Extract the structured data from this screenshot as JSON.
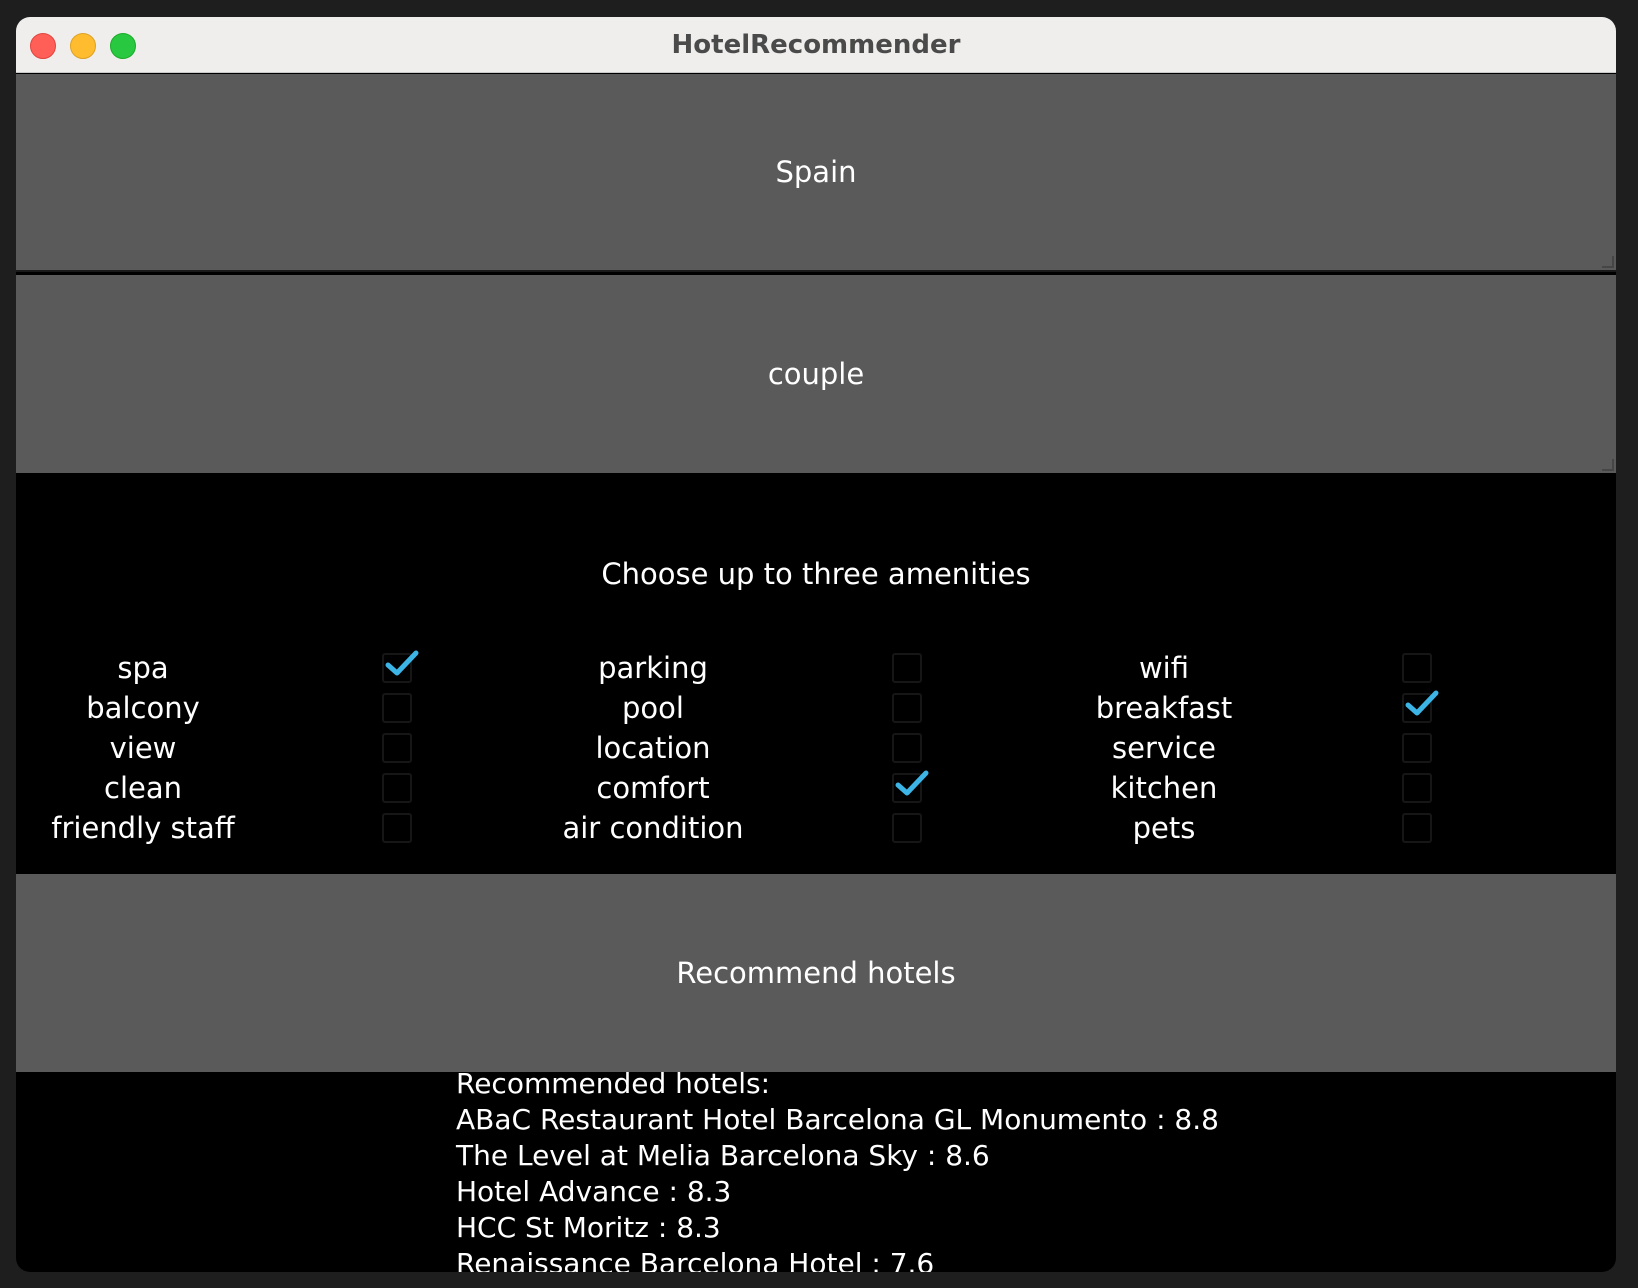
{
  "window": {
    "title": "HotelRecommender"
  },
  "country_field": {
    "value": "Spain"
  },
  "traveler_field": {
    "value": "couple"
  },
  "amenities": {
    "heading": "Choose up to three amenities",
    "columns": [
      [
        {
          "label": "spa",
          "checked": true
        },
        {
          "label": "balcony",
          "checked": false
        },
        {
          "label": "view",
          "checked": false
        },
        {
          "label": "clean",
          "checked": false
        },
        {
          "label": "friendly staff",
          "checked": false
        }
      ],
      [
        {
          "label": "parking",
          "checked": false
        },
        {
          "label": "pool",
          "checked": false
        },
        {
          "label": "location",
          "checked": false
        },
        {
          "label": "comfort",
          "checked": true
        },
        {
          "label": "air condition",
          "checked": false
        }
      ],
      [
        {
          "label": "wifi",
          "checked": false
        },
        {
          "label": "breakfast",
          "checked": true
        },
        {
          "label": "service",
          "checked": false
        },
        {
          "label": "kitchen",
          "checked": false
        },
        {
          "label": "pets",
          "checked": false
        }
      ]
    ],
    "check_color": "#3db4e6"
  },
  "recommend_button": {
    "label": "Recommend hotels"
  },
  "results": {
    "heading": "Recommended hotels:",
    "lines": [
      "ABaC Restaurant Hotel Barcelona GL Monumento : 8.8",
      "The Level at Melia Barcelona Sky : 8.6",
      "Hotel Advance : 8.3",
      "HCC St Moritz : 8.3",
      "Renaissance Barcelona Hotel : 7.6"
    ]
  }
}
